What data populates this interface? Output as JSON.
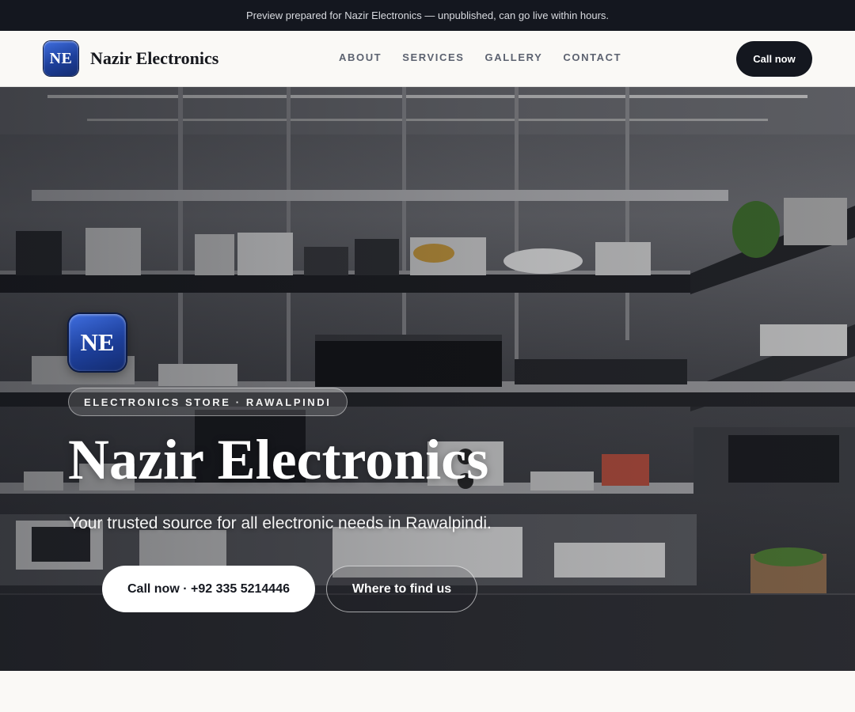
{
  "preview_banner": "Preview prepared for Nazir Electronics — unpublished, can go live within hours.",
  "header": {
    "logo_initials": "NE",
    "brand_name": "Nazir Electronics",
    "nav": [
      "ABOUT",
      "SERVICES",
      "GALLERY",
      "CONTACT"
    ],
    "cta_label": "Call now"
  },
  "hero": {
    "badge_initials": "NE",
    "tag": "ELECTRONICS STORE · RAWALPINDI",
    "title": "Nazir Electronics",
    "subtitle": "Your trusted source for all electronic needs in Rawalpindi.",
    "primary_button": "Call now · +92 335 5214446",
    "secondary_button": "Where to find us",
    "background_image": "electronics-store-shelves"
  },
  "colors": {
    "dark": "#14171f",
    "brand_blue": "#1d3f9a",
    "page_background": "#faf9f6"
  }
}
